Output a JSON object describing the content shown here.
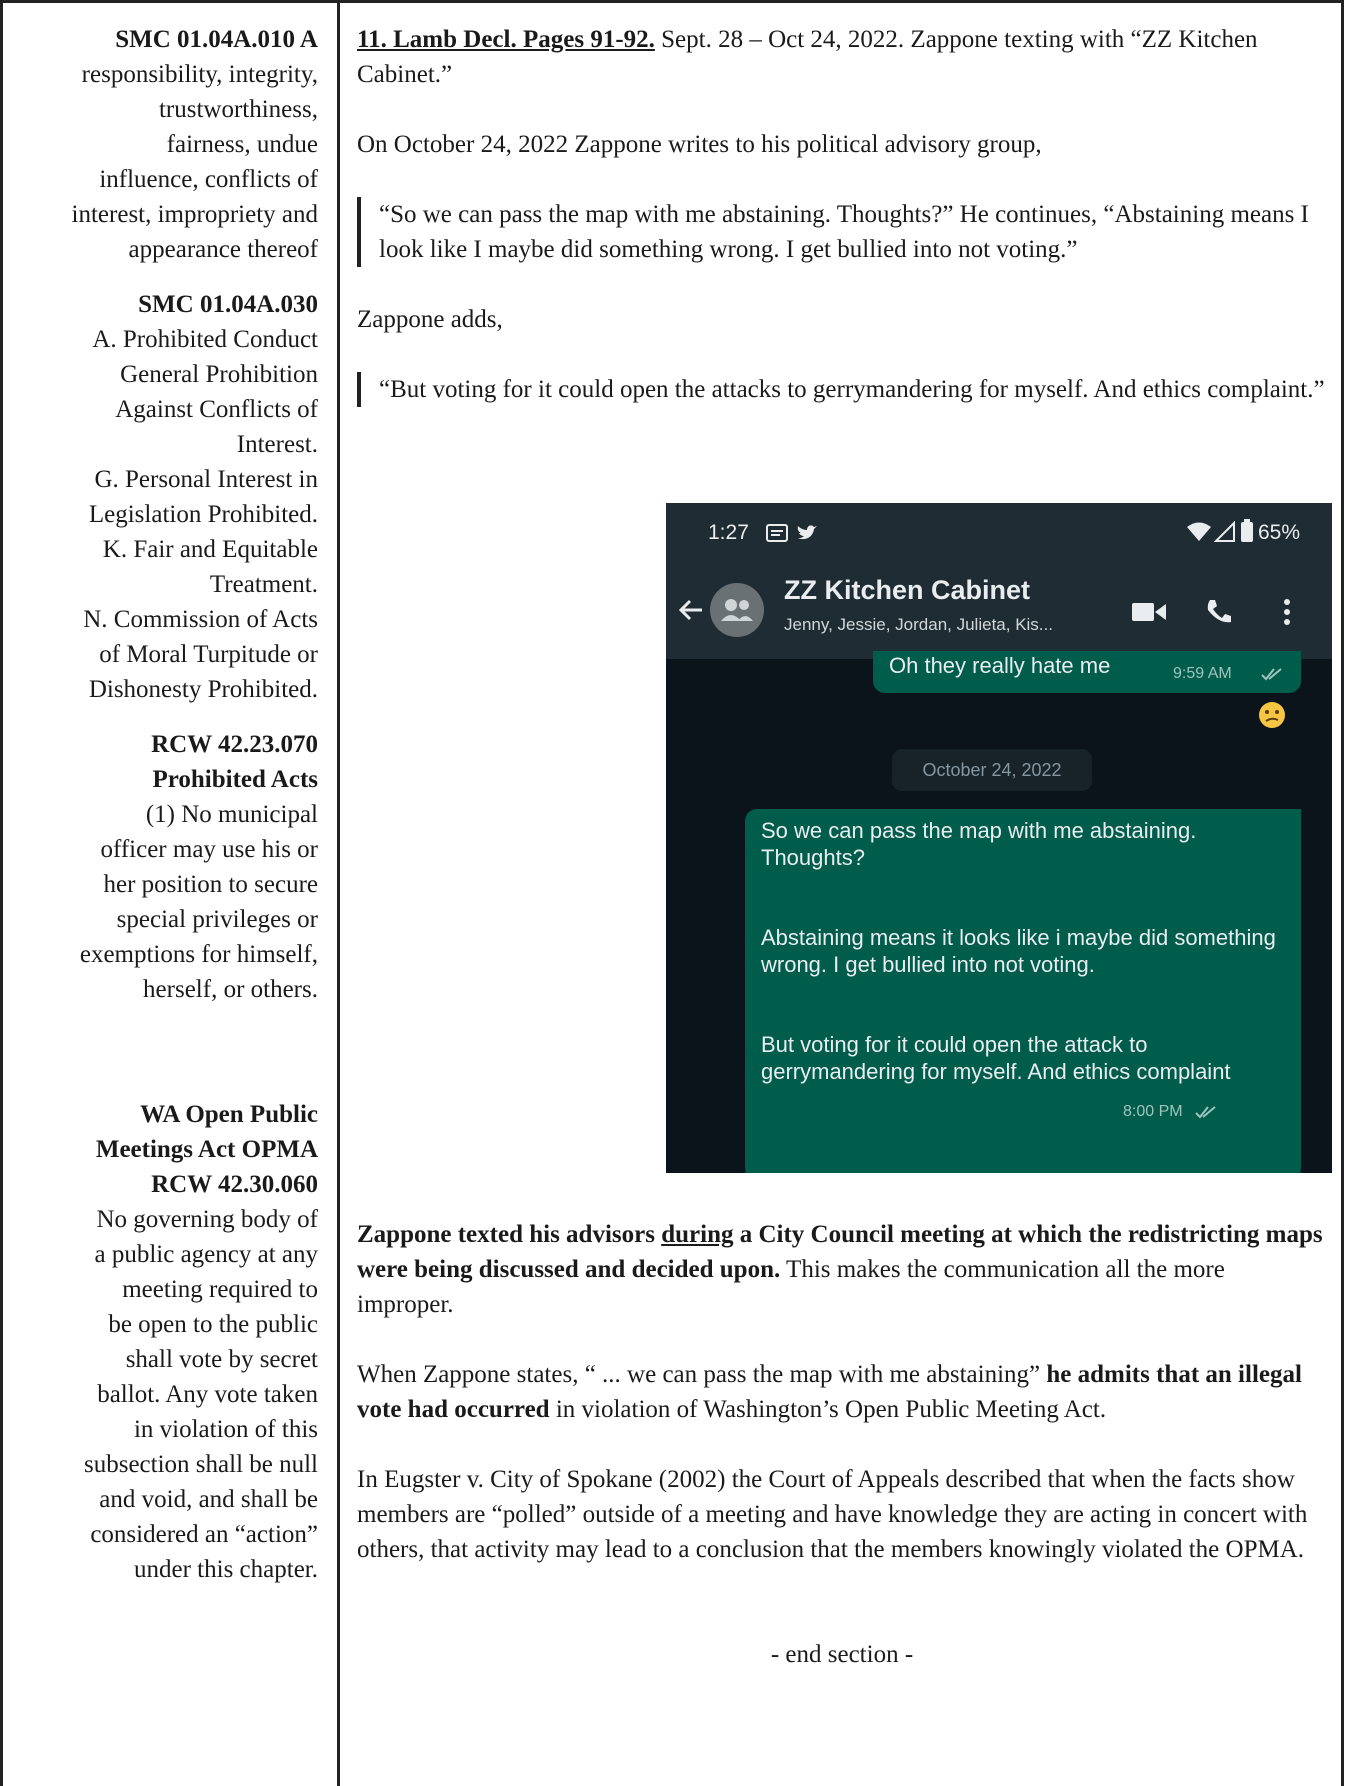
{
  "sidebar": {
    "smc010_head": "SMC 01.04A.010 A",
    "smc010_lines": [
      "responsibility, integrity,",
      "trustworthiness,",
      "fairness, undue",
      "influence, conflicts of",
      "interest, impropriety and",
      "appearance thereof"
    ],
    "smc030_head": "SMC 01.04A.030",
    "smc030_lines": [
      "A. Prohibited Conduct",
      "General Prohibition",
      "Against Conflicts of",
      "Interest.",
      "G. Personal Interest in",
      "Legislation Prohibited.",
      "K. Fair and Equitable",
      "Treatment.",
      "N. Commission of Acts",
      "of Moral Turpitude or",
      "Dishonesty Prohibited."
    ],
    "rcw070_head1": "RCW 42.23.070",
    "rcw070_head2": "Prohibited Acts",
    "rcw070_lines": [
      "(1) No municipal",
      "officer may use his or",
      "her position to secure",
      "special privileges or",
      "exemptions for himself,",
      "herself, or others."
    ],
    "opma_head1": "WA Open Public",
    "opma_head2": "Meetings Act OPMA",
    "opma_head3": "RCW 42.30.060",
    "opma_lines": [
      "No governing body of",
      "a public agency at any",
      "meeting required to",
      "be open to the public",
      "shall vote by secret",
      "ballot. Any vote taken",
      "in violation of this",
      "subsection shall be null",
      "and void, and shall be",
      "considered an “action”",
      "under this chapter."
    ]
  },
  "main": {
    "ref_label": "11. Lamb Decl. Pages 91-92.",
    "ref_rest": "  Sept. 28 – Oct 24, 2022.  Zappone texting with “ZZ Kitchen Cabinet.”",
    "intro": "On October 24, 2022 Zappone writes to his political advisory group,",
    "quote1": "“So we can pass the map with me abstaining. Thoughts?” He continues, “Abstaining means I look like I maybe did something wrong. I get bullied into not voting.”",
    "adds": "Zappone adds,",
    "quote2": "“But voting for it could open the attacks to gerrymandering for myself. And ethics complaint.”",
    "p1_bold1": "Zappone texted his advisors ",
    "p1_under": "during",
    "p1_bold2": " a City Council meeting at which the redistricting maps were being discussed and decided upon.",
    "p1_rest": "  This makes the communication all the more improper.",
    "p2_a": "When Zappone states, “ ... we can pass the map with me abstaining” ",
    "p2_bold": "he admits that an illegal vote had occurred",
    "p2_b": " in violation of Washington’s Open Public Meeting Act.",
    "p3": "In Eugster v. City of Spokane (2002) the Court of Appeals described that when the facts show members are “polled” outside of a meeting and have knowledge they are acting in concert with others, that activity may lead to a conclusion that the members knowingly violated the OPMA.",
    "end": "- end section -"
  },
  "phone": {
    "time": "1:27",
    "battery": "65%",
    "chat_title": "ZZ Kitchen Cabinet",
    "chat_members": "Jenny, Jessie, Jordan, Julieta, Kis...",
    "prev_msg": "Oh they really hate me",
    "prev_time": "9:59 AM",
    "date_chip": "October 24, 2022",
    "msg_p1": "So we can pass the map with me abstaining. Thoughts?",
    "msg_p2": "Abstaining means it looks like i maybe did something wrong. I get bullied into not voting.",
    "msg_p3": "But voting for it could open the attack to gerrymandering for myself. And ethics complaint",
    "msg_time": "8:00 PM",
    "colors": {
      "bar": "#1f2c33",
      "chat_bg": "#0b141a",
      "bubble": "#005c4b"
    },
    "icons": [
      "message-icon",
      "twitter-icon",
      "wifi-icon",
      "signal-icon",
      "battery-icon",
      "back-arrow-icon",
      "group-avatar-icon",
      "video-call-icon",
      "phone-call-icon",
      "more-options-icon",
      "double-check-icon",
      "confused-emoji-icon"
    ]
  }
}
